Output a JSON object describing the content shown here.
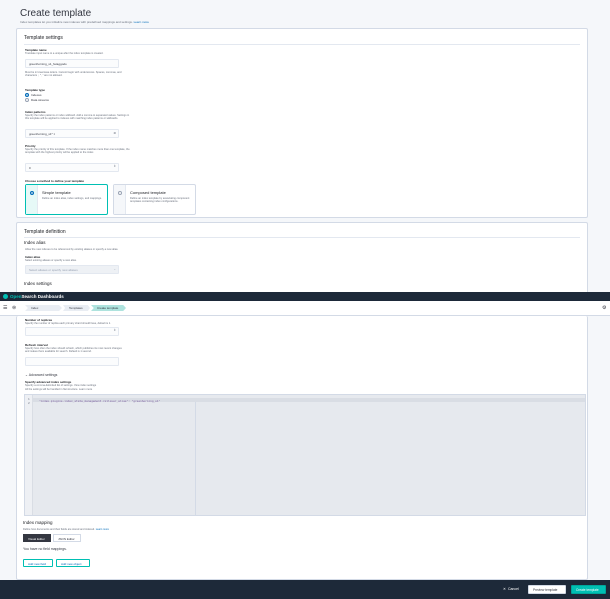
{
  "page": {
    "title": "Create template",
    "subtitle": "Index templates let you initialize new indexes with predefined mappings and settings.",
    "learn_more": "Learn more"
  },
  "template_settings": {
    "title": "Template settings",
    "name_label": "Template name",
    "name_help": "Translate input name to a unique after the index template is created.",
    "name_value": "greenhorning_s1_faraggodo",
    "name_constraint": "Must be in lowercase letters. Cannot begin with underscores. Spaces, commas, and characters :, *, \" are not allowed.",
    "type_label": "Template type",
    "type_options": [
      "Indexes",
      "Data streams"
    ],
    "type_selected": 0,
    "patterns_label": "Index patterns",
    "patterns_help": "Specify the index patterns or index wildcard. Add a comma to separated values. Settings in this template will be applied to indexes with matching index patterns or wildcards.",
    "pattern_value": "greenhorning_s1* ×",
    "priority_label": "Priority",
    "priority_help": "Specify the priority of this template. If the index name matches more than one template, the template with the highest priority will be applied to the index.",
    "priority_value": "0",
    "method_label": "Choose a method to define your template",
    "methods": [
      {
        "title": "Simple template",
        "desc": "Define an index alias, index settings, and mappings."
      },
      {
        "title": "Composed template",
        "desc": "Define an index template by associating component templates containing index configurations."
      }
    ],
    "method_selected": 0
  },
  "template_definition": {
    "title": "Template definition",
    "alias_title": "Index alias",
    "alias_help": "Allow the new indexes to be referenced by existing aliases or specify a new alias.",
    "alias_label": "Index alias",
    "alias_sub": "Select existing aliases or specify a new alias.",
    "alias_placeholder": "Select aliases or specify new aliases",
    "settings_title": "Index settings"
  },
  "topbar": {
    "brand_a": "Open",
    "brand_b": "Search Dashboards"
  },
  "breadcrumbs": [
    "Index Management",
    "Templates",
    "Create template"
  ],
  "settings_cont": {
    "replicas_label": "Number of replicas",
    "replicas_help": "Specify the number of replica each primary shard should have, default is 1.",
    "refresh_label": "Refresh interval",
    "refresh_help": "Specify how often the index should refresh, which publishes its most recent changes and makes them available for search. Default is 1 second.",
    "advanced_toggle": "Advanced settings",
    "advanced_label": "Specify advanced index settings",
    "advanced_help": "Specify a comma-delimited list of settings. View index settings",
    "advanced_help2": "All the settings will be handled in flat structure. Learn more",
    "code_line": "\"index.plugins.index_state_management.rollover_alias\": \"greenhorning_s1\""
  },
  "mapping": {
    "title": "Index mapping",
    "help": "Define how documents and their fields are stored and indexed.",
    "learn_more": "Learn more",
    "tabs": [
      "Visual Editor",
      "JSON Editor"
    ],
    "tab_selected": 0,
    "empty": "You have no field mappings.",
    "add_field": "Add new field",
    "add_object": "Add new object"
  },
  "footer": {
    "cancel": "Cancel",
    "preview": "Preview template",
    "create": "Create template"
  },
  "colors": {
    "accent": "#00bfb3",
    "link": "#006bb8",
    "dark_bar": "#1d2939"
  }
}
